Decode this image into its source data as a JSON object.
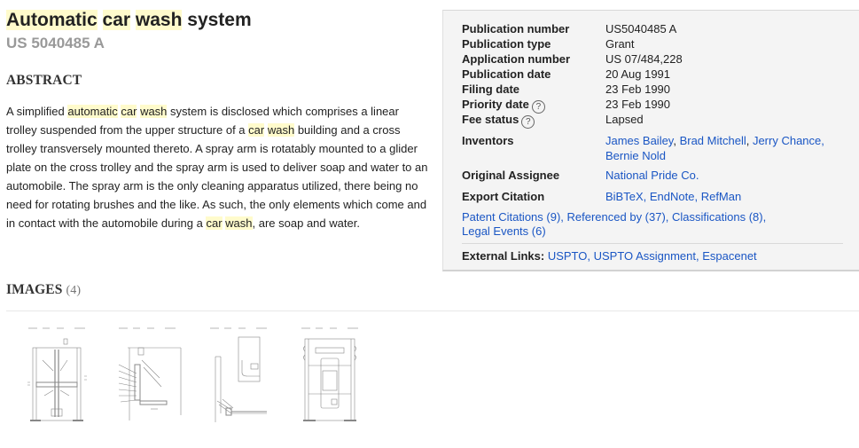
{
  "title": {
    "parts": [
      {
        "text": "Automatic",
        "highlight": true
      },
      {
        "text": " ",
        "highlight": false
      },
      {
        "text": "car",
        "highlight": true
      },
      {
        "text": " ",
        "highlight": false
      },
      {
        "text": "wash",
        "highlight": true
      },
      {
        "text": " system",
        "highlight": false
      }
    ]
  },
  "publication_display": "US 5040485 A",
  "abstract": {
    "heading": "ABSTRACT",
    "segments": [
      {
        "text": "A simplified ",
        "highlight": false
      },
      {
        "text": "automatic",
        "highlight": true
      },
      {
        "text": " ",
        "highlight": false
      },
      {
        "text": "car",
        "highlight": true
      },
      {
        "text": " ",
        "highlight": false
      },
      {
        "text": "wash",
        "highlight": true
      },
      {
        "text": " system is disclosed which comprises a linear trolley suspended from the upper structure of a ",
        "highlight": false
      },
      {
        "text": "car",
        "highlight": true
      },
      {
        "text": " ",
        "highlight": false
      },
      {
        "text": "wash",
        "highlight": true
      },
      {
        "text": " building and a cross trolley transversely mounted thereto. A spray arm is rotatably mounted to a glider plate on the cross trolley and the spray arm is used to deliver soap and water to an automobile. The spray arm is the only cleaning apparatus utilized, there being no need for rotating brushes and the like. As such, the only elements which come and in contact with the automobile during a ",
        "highlight": false
      },
      {
        "text": "car",
        "highlight": true
      },
      {
        "text": " ",
        "highlight": false
      },
      {
        "text": "wash",
        "highlight": true
      },
      {
        "text": ", are soap and water.",
        "highlight": false
      }
    ]
  },
  "details": {
    "publication_number": {
      "label": "Publication number",
      "value": "US5040485 A"
    },
    "publication_type": {
      "label": "Publication type",
      "value": "Grant"
    },
    "application_number": {
      "label": "Application number",
      "value": "US 07/484,228"
    },
    "publication_date": {
      "label": "Publication date",
      "value": "20 Aug 1991"
    },
    "filing_date": {
      "label": "Filing date",
      "value": "23 Feb 1990"
    },
    "priority_date": {
      "label": "Priority date",
      "value": "23 Feb 1990",
      "help": "?"
    },
    "fee_status": {
      "label": "Fee status",
      "value": "Lapsed",
      "help": "?"
    },
    "inventors": {
      "label": "Inventors",
      "line1": "James Bailey, Brad Mitchell, Jerry Chance,",
      "line2": "Bernie Nold",
      "names": [
        "James Bailey",
        "Brad Mitchell",
        "Jerry Chance",
        "Bernie Nold"
      ]
    },
    "original_assignee": {
      "label": "Original Assignee",
      "value": "National Pride Co."
    },
    "export_citation": {
      "label": "Export Citation",
      "links": [
        "BiBTeX",
        "EndNote",
        "RefMan"
      ]
    },
    "sections": {
      "patent_citations": "Patent Citations (9)",
      "referenced_by": "Referenced by (37)",
      "classifications": "Classifications (8)",
      "legal_events": "Legal Events (6)"
    },
    "external_links": {
      "label": "External Links:",
      "links": [
        "USPTO",
        "USPTO Assignment",
        "Espacenet"
      ]
    }
  },
  "images": {
    "heading": "IMAGES",
    "count": "(4)",
    "thumbnails": [
      "drawing-sheet-1",
      "drawing-sheet-2",
      "drawing-sheet-3",
      "drawing-sheet-4"
    ]
  },
  "colors": {
    "highlight": "#fffbcc",
    "link": "#1a56c4",
    "infobox_bg": "#f4f4f4",
    "muted": "#999999"
  }
}
